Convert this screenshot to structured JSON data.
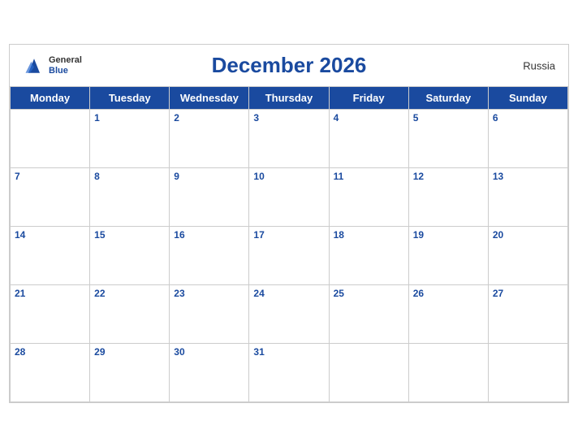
{
  "header": {
    "title": "December 2026",
    "country": "Russia",
    "logo_general": "General",
    "logo_blue": "Blue"
  },
  "weekdays": [
    "Monday",
    "Tuesday",
    "Wednesday",
    "Thursday",
    "Friday",
    "Saturday",
    "Sunday"
  ],
  "weeks": [
    [
      null,
      1,
      2,
      3,
      4,
      5,
      6
    ],
    [
      7,
      8,
      9,
      10,
      11,
      12,
      13
    ],
    [
      14,
      15,
      16,
      17,
      18,
      19,
      20
    ],
    [
      21,
      22,
      23,
      24,
      25,
      26,
      27
    ],
    [
      28,
      29,
      30,
      31,
      null,
      null,
      null
    ]
  ],
  "colors": {
    "header_bg": "#1a4a9f",
    "header_text": "#ffffff",
    "title_color": "#1a4a9f"
  }
}
